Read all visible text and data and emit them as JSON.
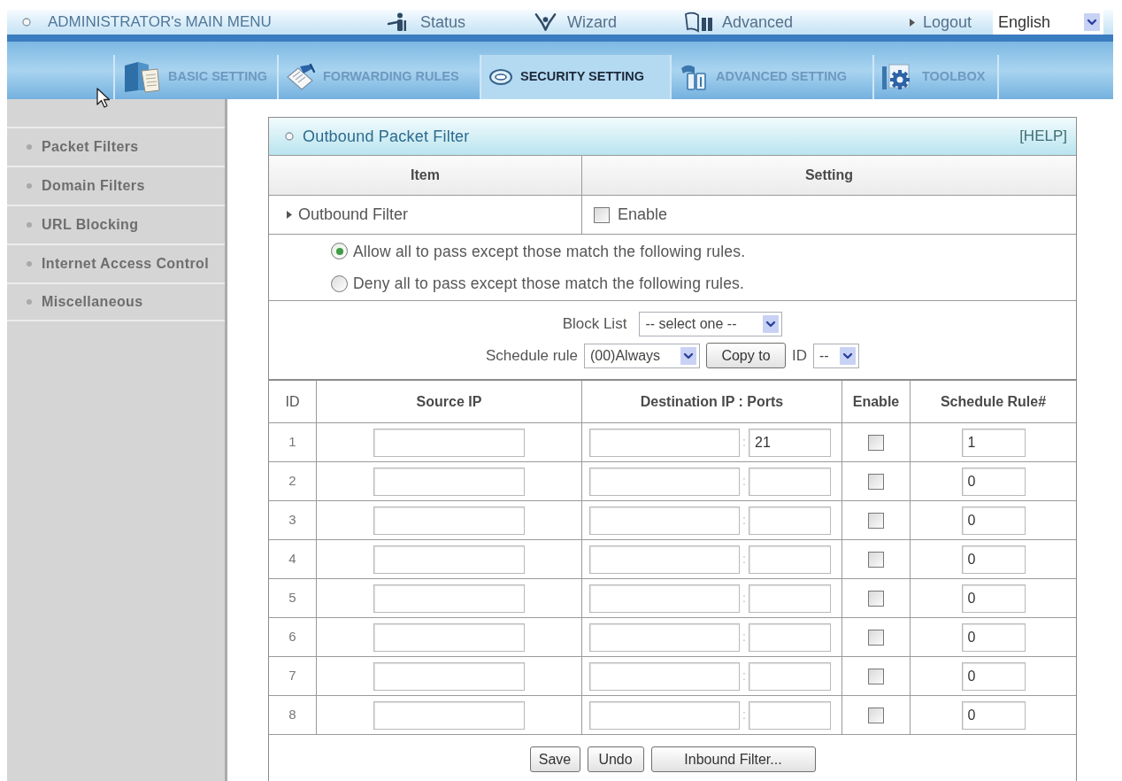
{
  "top_menu": {
    "title": "ADMINISTRATOR's MAIN MENU",
    "links": [
      {
        "kind": "status",
        "label": "Status"
      },
      {
        "kind": "wizard",
        "label": "Wizard"
      },
      {
        "kind": "advanced",
        "label": "Advanced"
      }
    ],
    "logout": "Logout",
    "language": "English"
  },
  "tabs": [
    {
      "kind": "basic",
      "label": "BASIC SETTING",
      "selected": false
    },
    {
      "kind": "forwarding",
      "label": "FORWARDING RULES",
      "selected": false
    },
    {
      "kind": "security",
      "label": "SECURITY SETTING",
      "selected": true
    },
    {
      "kind": "advanced",
      "label": "ADVANCED SETTING",
      "selected": false
    },
    {
      "kind": "toolbox",
      "label": "TOOLBOX",
      "selected": false
    }
  ],
  "sidebar": {
    "items": [
      "Packet Filters",
      "Domain Filters",
      "URL Blocking",
      "Internet Access Control",
      "Miscellaneous"
    ]
  },
  "panel": {
    "title": "Outbound Packet Filter",
    "help": "[HELP]",
    "columns": [
      "Item",
      "Setting"
    ],
    "outbound_filter": {
      "label": "Outbound Filter",
      "checkbox_label": "Enable",
      "checked": false
    },
    "policy_options": [
      {
        "label": "Allow all to pass except those match the following rules.",
        "selected": true
      },
      {
        "label": "Deny all to pass except those match the following rules.",
        "selected": false
      }
    ],
    "block_list": {
      "label": "Block List",
      "value": "-- select one --"
    },
    "schedule": {
      "label": "Schedule rule",
      "value": "(00)Always",
      "copy_button": "Copy to",
      "id_label": "ID",
      "id_value": "--"
    },
    "rules": {
      "columns": [
        "ID",
        "Source IP",
        "Destination IP : Ports",
        "Enable",
        "Schedule Rule#"
      ],
      "rows": [
        {
          "id": "1",
          "separator": ":",
          "port": "21",
          "enabled": false,
          "schedule_rule": "1"
        },
        {
          "id": "2",
          "separator": ":",
          "enabled": false,
          "schedule_rule": "0"
        },
        {
          "id": "3",
          "separator": ":",
          "enabled": false,
          "schedule_rule": "0"
        },
        {
          "id": "4",
          "separator": ":",
          "enabled": false,
          "schedule_rule": "0"
        },
        {
          "id": "5",
          "separator": ":",
          "enabled": false,
          "schedule_rule": "0"
        },
        {
          "id": "6",
          "separator": ":",
          "enabled": false,
          "schedule_rule": "0"
        },
        {
          "id": "7",
          "separator": ":",
          "enabled": false,
          "schedule_rule": "0"
        },
        {
          "id": "8",
          "separator": ":",
          "enabled": false,
          "schedule_rule": "0"
        }
      ]
    },
    "buttons": [
      "Save",
      "Undo",
      "Inbound Filter..."
    ]
  }
}
